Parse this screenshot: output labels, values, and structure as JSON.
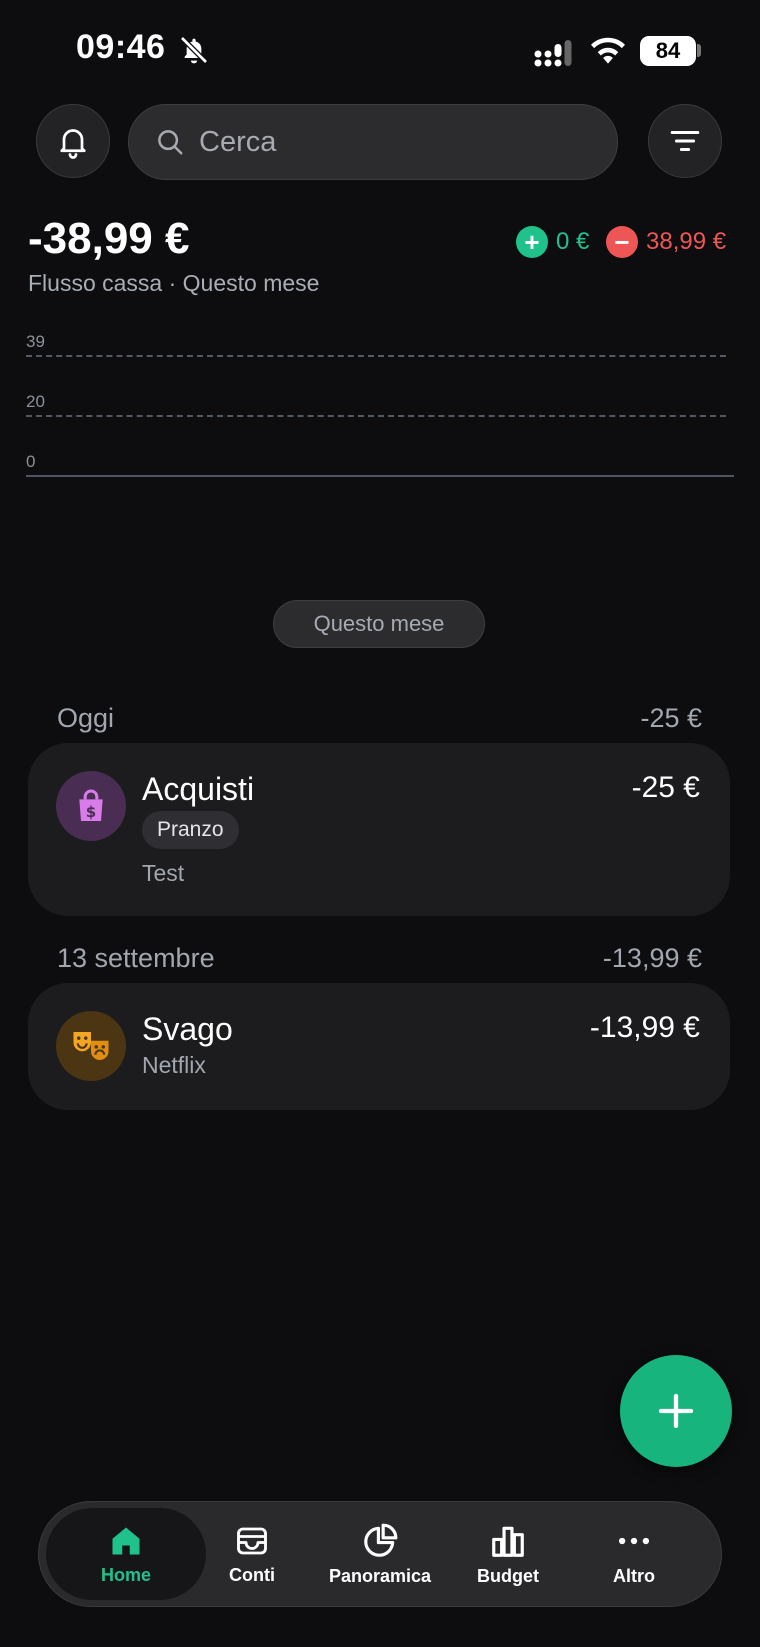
{
  "status_bar": {
    "time": "09:46",
    "battery": "84"
  },
  "search": {
    "placeholder": "Cerca"
  },
  "summary": {
    "total": "-38,99 €",
    "subtitle": "Flusso cassa · Questo mese",
    "income": "0 €",
    "expense": "38,99 €"
  },
  "chart_data": {
    "type": "bar",
    "ticks": [
      "39",
      "20",
      "0"
    ],
    "ylim": [
      0,
      39
    ],
    "values": []
  },
  "period": {
    "label": "Questo mese"
  },
  "groups": [
    {
      "label": "Oggi",
      "total": "-25 €",
      "transactions": [
        {
          "category": "Acquisti",
          "amount": "-25 €",
          "tag": "Pranzo",
          "note": "Test",
          "icon": "shopping-bag-icon",
          "color": "#d77ce8"
        }
      ]
    },
    {
      "label": "13 settembre",
      "total": "-13,99 €",
      "transactions": [
        {
          "category": "Svago",
          "amount": "-13,99 €",
          "note": "Netflix",
          "icon": "theater-masks-icon",
          "color": "#f5a524"
        }
      ]
    }
  ],
  "nav": [
    {
      "label": "Home",
      "icon": "home-icon",
      "active": true
    },
    {
      "label": "Conti",
      "icon": "wallet-icon",
      "active": false
    },
    {
      "label": "Panoramica",
      "icon": "pie-chart-icon",
      "active": false
    },
    {
      "label": "Budget",
      "icon": "bar-chart-icon",
      "active": false
    },
    {
      "label": "Altro",
      "icon": "more-icon",
      "active": false
    }
  ],
  "colors": {
    "accent": "#1fc28a",
    "negative": "#ee5656",
    "background": "#0d0d0f"
  }
}
